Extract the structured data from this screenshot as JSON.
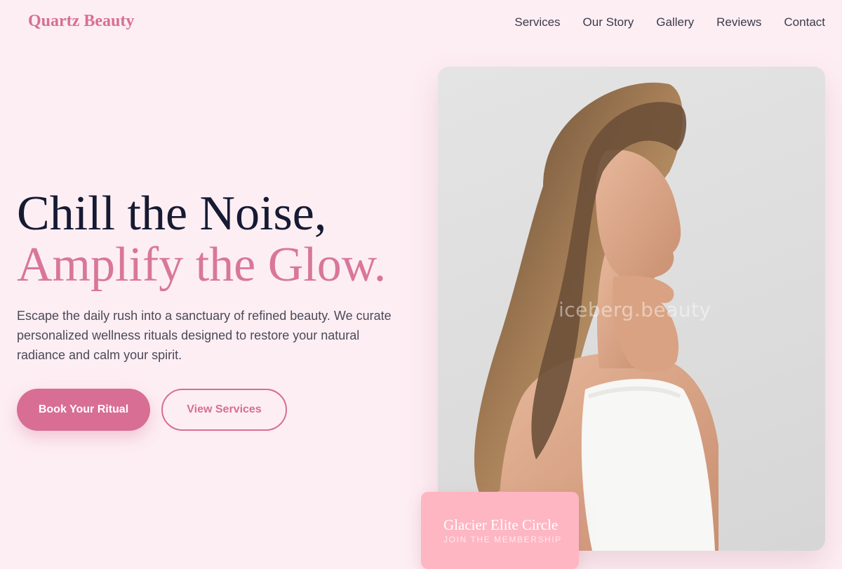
{
  "brand": {
    "name": "Quartz Beauty",
    "accent_color": "#d86e93",
    "background_color": "#fdeef3"
  },
  "nav": {
    "items": [
      {
        "label": "Services"
      },
      {
        "label": "Our Story"
      },
      {
        "label": "Gallery"
      },
      {
        "label": "Reviews"
      },
      {
        "label": "Contact"
      }
    ]
  },
  "hero": {
    "headline_line1": "Chill the Noise,",
    "headline_line2": "Amplify the Glow.",
    "subtext": "Escape the daily rush into a sanctuary of refined beauty. We curate personalized wellness rituals designed to restore your natural radiance and calm your spirit.",
    "primary_cta": "Book Your Ritual",
    "secondary_cta": "View Services",
    "image_watermark": "iceberg.beauty"
  },
  "membership_card": {
    "title": "Glacier Elite Circle",
    "subtitle": "JOIN THE MEMBERSHIP",
    "color": "#feb6c3"
  }
}
